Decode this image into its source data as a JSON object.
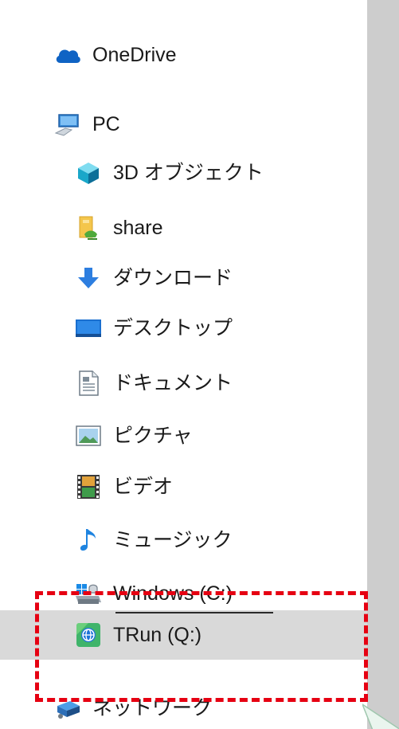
{
  "navigation": {
    "items": [
      {
        "label": "OneDrive",
        "icon": "onedrive-cloud-icon",
        "level": 0,
        "selected": false
      },
      {
        "label": "PC",
        "icon": "pc-icon",
        "level": 0,
        "selected": false
      },
      {
        "label": "3D オブジェクト",
        "icon": "3d-objects-icon",
        "level": 1,
        "selected": false
      },
      {
        "label": "share",
        "icon": "shared-folder-icon",
        "level": 1,
        "selected": false
      },
      {
        "label": "ダウンロード",
        "icon": "download-arrow-icon",
        "level": 1,
        "selected": false
      },
      {
        "label": "デスクトップ",
        "icon": "desktop-icon",
        "level": 1,
        "selected": false
      },
      {
        "label": "ドキュメント",
        "icon": "documents-icon",
        "level": 1,
        "selected": false
      },
      {
        "label": "ピクチャ",
        "icon": "pictures-icon",
        "level": 1,
        "selected": false
      },
      {
        "label": "ビデオ",
        "icon": "videos-icon",
        "level": 1,
        "selected": false
      },
      {
        "label": "ミュージック",
        "icon": "music-note-icon",
        "level": 1,
        "selected": false
      },
      {
        "label": "Windows (C:)",
        "icon": "windows-drive-icon",
        "level": 1,
        "selected": false
      },
      {
        "label": "TRun (Q:)",
        "icon": "trun-drive-icon",
        "level": 1,
        "selected": true
      },
      {
        "label": "ネットワーク",
        "icon": "network-icon",
        "level": 0,
        "selected": false
      }
    ]
  },
  "colors": {
    "selection_background": "#d9d9d9",
    "annotation_red": "#e60012",
    "scrollbar_track": "#cdcdcd"
  }
}
